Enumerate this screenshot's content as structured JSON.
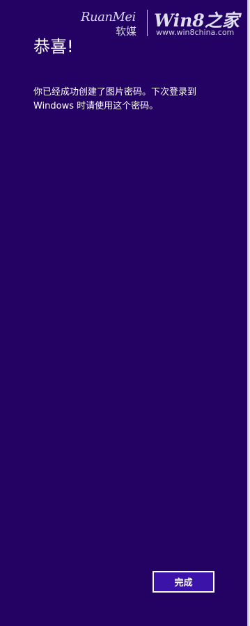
{
  "watermark": {
    "brand_latin": "RuanMei",
    "brand_cn": "软媒",
    "site_name": "Win8之家",
    "site_url": "www.win8china.com"
  },
  "dialog": {
    "title": "恭喜!",
    "message": "你已经成功创建了图片密码。下次登录到 Windows 时请使用这个密码。",
    "done_button_label": "完成"
  },
  "colors": {
    "background": "#230264",
    "button_fill": "#3b13a8",
    "text": "#ffffff"
  }
}
